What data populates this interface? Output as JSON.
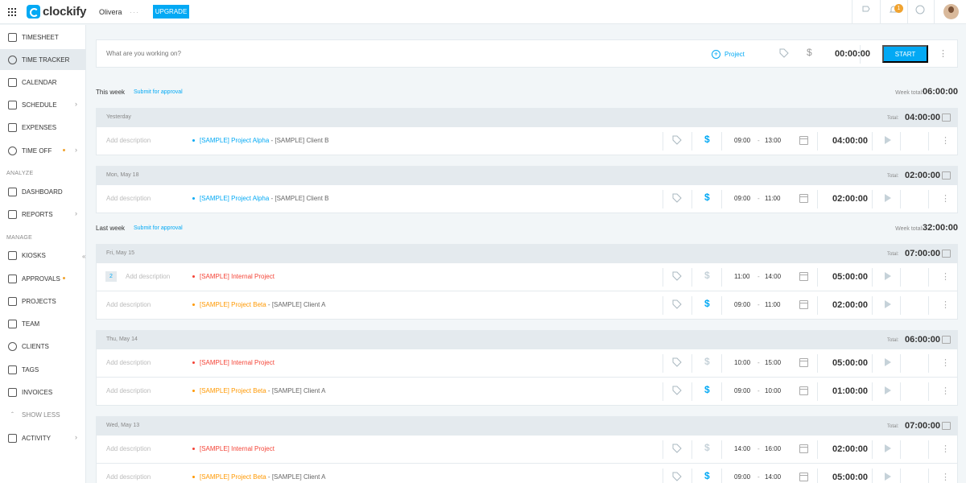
{
  "header": {
    "logo_text": "clockify",
    "workspace": "Olivera",
    "workspace_more": "···",
    "upgrade_label": "UPGRADE",
    "notification_count": "1"
  },
  "sidebar": {
    "items": [
      {
        "label": "TIMESHEET",
        "icon": "timesheet-icon"
      },
      {
        "label": "TIME TRACKER",
        "icon": "clock-icon"
      },
      {
        "label": "CALENDAR",
        "icon": "calendar-icon"
      },
      {
        "label": "SCHEDULE",
        "icon": "schedule-icon"
      },
      {
        "label": "EXPENSES",
        "icon": "receipt-icon"
      },
      {
        "label": "TIME OFF",
        "icon": "time-off-icon"
      },
      {
        "label": "DASHBOARD",
        "icon": "dashboard-icon"
      },
      {
        "label": "REPORTS",
        "icon": "reports-icon"
      },
      {
        "label": "KIOSKS",
        "icon": "kiosk-icon"
      },
      {
        "label": "APPROVALS",
        "icon": "approvals-icon"
      },
      {
        "label": "PROJECTS",
        "icon": "projects-icon"
      },
      {
        "label": "TEAM",
        "icon": "team-icon"
      },
      {
        "label": "CLIENTS",
        "icon": "clients-icon"
      },
      {
        "label": "TAGS",
        "icon": "tag-icon"
      },
      {
        "label": "INVOICES",
        "icon": "invoice-icon"
      },
      {
        "label": "SHOW LESS",
        "icon": "chevron-up-icon"
      },
      {
        "label": "ACTIVITY",
        "icon": "activity-icon"
      }
    ],
    "sections": {
      "analyze": "ANALYZE",
      "manage": "MANAGE"
    }
  },
  "timer": {
    "placeholder": "What are you working on?",
    "project_label": "Project",
    "time": "00:00:00",
    "start_label": "START"
  },
  "weeks": [
    {
      "label": "This week",
      "submit_label": "Submit for approval",
      "total_label": "Week total:",
      "total": "06:00:00",
      "days": [
        {
          "date": "Yesterday",
          "total_label": "Total:",
          "total": "04:00:00",
          "entries": [
            {
              "desc": "Add description",
              "project": "[SAMPLE] Project Alpha",
              "client": " - [SAMPLE] Client B",
              "start": "09:00",
              "end": "13:00",
              "duration": "04:00:00",
              "billable": true
            }
          ]
        },
        {
          "date": "Mon, May 18",
          "total_label": "Total:",
          "total": "02:00:00",
          "entries": [
            {
              "desc": "Add description",
              "project": "[SAMPLE] Project Alpha",
              "client": " - [SAMPLE] Client B",
              "start": "09:00",
              "end": "11:00",
              "duration": "02:00:00",
              "billable": true
            }
          ]
        }
      ]
    },
    {
      "label": "Last week",
      "submit_label": "Submit for approval",
      "total_label": "Week total:",
      "total": "32:00:00",
      "days": [
        {
          "date": "Fri, May 15",
          "total_label": "Total:",
          "total": "07:00:00",
          "entries": [
            {
              "group_count": "2",
              "desc": "Add description",
              "project": "[SAMPLE] Internal Project",
              "client": "",
              "start": "11:00",
              "end": "14:00",
              "duration": "05:00:00",
              "billable": false
            },
            {
              "desc": "Add description",
              "project": "[SAMPLE] Project Beta",
              "client": " - [SAMPLE] Client A",
              "start": "09:00",
              "end": "11:00",
              "duration": "02:00:00",
              "billable": true
            }
          ]
        },
        {
          "date": "Thu, May 14",
          "total_label": "Total:",
          "total": "06:00:00",
          "entries": [
            {
              "desc": "Add description",
              "project": "[SAMPLE] Internal Project",
              "client": "",
              "start": "10:00",
              "end": "15:00",
              "duration": "05:00:00",
              "billable": false
            },
            {
              "desc": "Add description",
              "project": "[SAMPLE] Project Beta",
              "client": " - [SAMPLE] Client A",
              "start": "09:00",
              "end": "10:00",
              "duration": "01:00:00",
              "billable": true
            }
          ]
        },
        {
          "date": "Wed, May 13",
          "total_label": "Total:",
          "total": "07:00:00",
          "entries": [
            {
              "desc": "Add description",
              "project": "[SAMPLE] Internal Project",
              "client": "",
              "start": "14:00",
              "end": "16:00",
              "duration": "02:00:00",
              "billable": false
            },
            {
              "desc": "Add description",
              "project": "[SAMPLE] Project Beta",
              "client": " - [SAMPLE] Client A",
              "start": "09:00",
              "end": "14:00",
              "duration": "05:00:00",
              "billable": true
            }
          ]
        }
      ]
    }
  ],
  "colors": {
    "accent": "#03a9f4",
    "project_alpha": "#03a9f4",
    "project_internal": "#f44336",
    "project_beta": "#ff9800",
    "non_billable": "#c6d2d9"
  },
  "symbols": {
    "dash": "-",
    "dollar": "$",
    "kebab": "⋮",
    "chevron_right": "›",
    "collapse": "«"
  }
}
